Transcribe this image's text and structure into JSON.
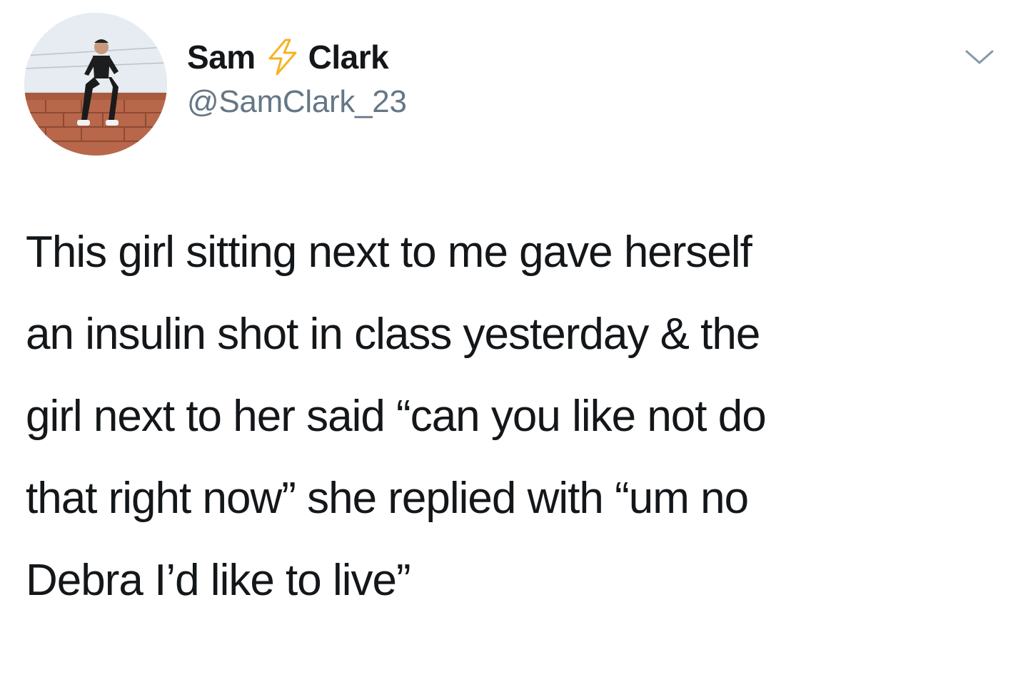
{
  "tweet": {
    "author": {
      "first_name": "Sam",
      "last_name": "Clark",
      "name_emoji_icon": "lightning-bolt-icon",
      "handle": "@SamClark_23",
      "avatar_icon": "profile-photo"
    },
    "menu_icon": "chevron-down-icon",
    "text_lines": [
      "This girl sitting next to me gave herself",
      "an insulin shot in class yesterday & the",
      "girl next to her said “can you like not do",
      "that right now” she replied with “um no",
      "Debra I’d like to live”"
    ]
  },
  "colors": {
    "name": "#14171a",
    "handle": "#657786",
    "text": "#14171a",
    "bolt": "#f5b323",
    "chevron": "#8899a6",
    "background": "#ffffff"
  }
}
